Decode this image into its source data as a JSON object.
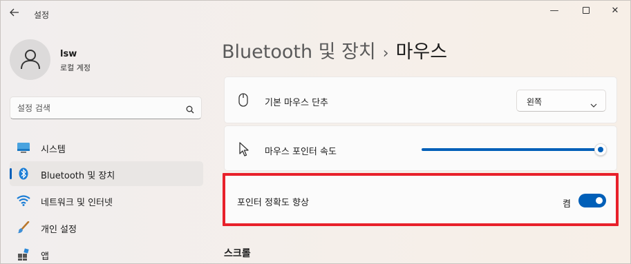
{
  "window": {
    "title": "설정",
    "back_icon": "arrow-left-icon",
    "controls": {
      "minimize": "—",
      "close": "✕"
    }
  },
  "profile": {
    "name": "lsw",
    "account_type": "로컬 계정"
  },
  "search": {
    "placeholder": "설정 검색"
  },
  "sidebar": {
    "items": [
      {
        "label": "시스템",
        "icon": "system-icon"
      },
      {
        "label": "Bluetooth 및 장치",
        "icon": "bluetooth-icon",
        "active": true
      },
      {
        "label": "네트워크 및 인터넷",
        "icon": "wifi-icon"
      },
      {
        "label": "개인 설정",
        "icon": "brush-icon"
      },
      {
        "label": "앱",
        "icon": "apps-icon"
      }
    ]
  },
  "breadcrumb": {
    "parent": "Bluetooth 및 장치",
    "separator": "›",
    "current": "마우스"
  },
  "settings": {
    "primary_button": {
      "label": "기본 마우스 단추",
      "value": "왼쪽"
    },
    "pointer_speed": {
      "label": "마우스 포인터 속도",
      "value_fraction": 1.0
    },
    "pointer_precision": {
      "label": "포인터 정확도 향상",
      "state": "켬",
      "on": true
    }
  },
  "sections": {
    "scroll_title": "스크롤"
  },
  "colors": {
    "accent": "#005fb8",
    "highlight": "#e8202a"
  }
}
